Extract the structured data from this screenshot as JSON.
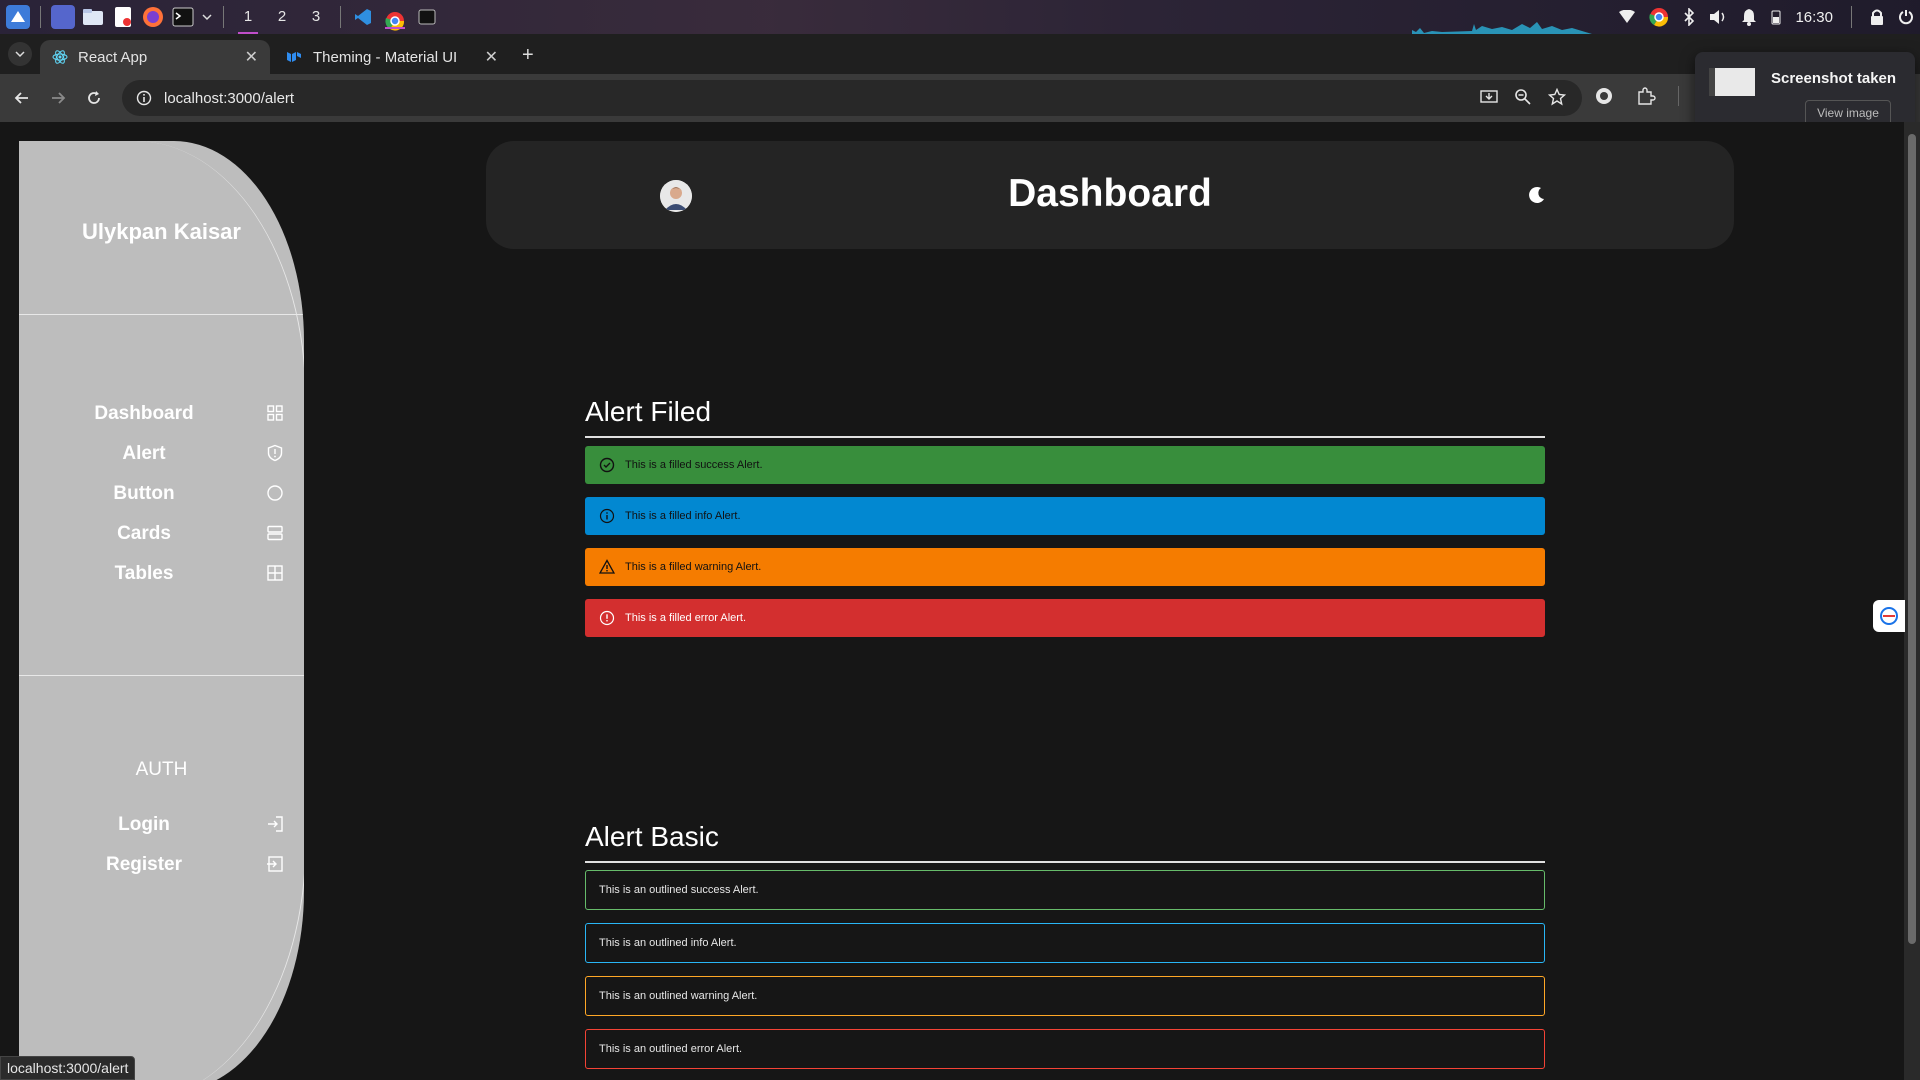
{
  "os": {
    "workspaces": [
      "1",
      "2",
      "3"
    ],
    "clock": "16:30",
    "tray_icons": [
      "wifi-icon",
      "chrome-icon",
      "bluetooth-icon",
      "volume-icon",
      "bell-icon",
      "battery-icon",
      "lock-icon",
      "power-icon"
    ]
  },
  "browser": {
    "tabs": [
      {
        "title": "React App",
        "active": true
      },
      {
        "title": "Theming - Material UI",
        "active": false
      }
    ],
    "url": "localhost:3000/alert",
    "status_url": "localhost:3000/alert"
  },
  "toast": {
    "title": "Screenshot taken",
    "button": "View image"
  },
  "sidebar": {
    "user_name": "Ulykpan Kaisar",
    "nav": [
      {
        "label": "Dashboard",
        "icon": "grid-icon"
      },
      {
        "label": "Alert",
        "icon": "shield-icon"
      },
      {
        "label": "Button",
        "icon": "circle-icon"
      },
      {
        "label": "Cards",
        "icon": "cards-icon"
      },
      {
        "label": "Tables",
        "icon": "table-icon"
      }
    ],
    "auth_title": "AUTH",
    "auth": [
      {
        "label": "Login",
        "icon": "login-icon"
      },
      {
        "label": "Register",
        "icon": "register-icon"
      }
    ]
  },
  "header": {
    "title": "Dashboard"
  },
  "filled": {
    "title": "Alert Filed",
    "alerts": [
      {
        "text": "This is a filled success Alert.",
        "color": "#388e3c"
      },
      {
        "text": "This is a filled info Alert.",
        "color": "#0288d1"
      },
      {
        "text": "This is a filled warning Alert.",
        "color": "#f57c00"
      },
      {
        "text": "This is a filled error Alert.",
        "color": "#d32f2f"
      }
    ]
  },
  "basic": {
    "title": "Alert Basic",
    "alerts": [
      {
        "text": "This is an outlined success Alert.",
        "color": "#66bb6a"
      },
      {
        "text": "This is an outlined info Alert.",
        "color": "#29b6f6"
      },
      {
        "text": "This is an outlined warning Alert.",
        "color": "#ffa726"
      },
      {
        "text": "This is an outlined error Alert.",
        "color": "#f44336"
      }
    ]
  }
}
